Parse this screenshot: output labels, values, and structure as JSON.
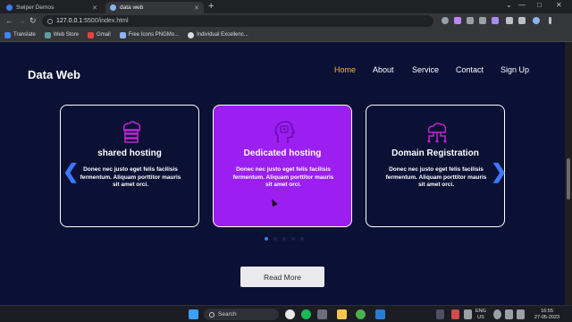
{
  "browser": {
    "tabs": [
      {
        "title": "Swiper Demos",
        "active": false
      },
      {
        "title": "data web",
        "active": true
      }
    ],
    "new_tab_icon": "+",
    "url": {
      "host": "127.0.0.1",
      "path": ":5500/index.html"
    },
    "nav_icons": {
      "back": "←",
      "forward": "→",
      "reload": "↻"
    },
    "window_controls": {
      "minimize": "—",
      "maximize": "□",
      "close": "✕",
      "dropdown": "⌄"
    },
    "bookmarks": [
      {
        "label": "Translate",
        "color": "#4285f4"
      },
      {
        "label": "Web Store",
        "color": "#5f9ea0"
      },
      {
        "label": "Gmail",
        "color": "#ea4335"
      },
      {
        "label": "Free Icons PNGMo...",
        "color": "#8ab4f8"
      },
      {
        "label": "Individual Excellenc...",
        "color": "#dadce0"
      }
    ]
  },
  "site": {
    "logo": "Data Web",
    "nav": [
      {
        "label": "Home",
        "active": true
      },
      {
        "label": "About",
        "active": false
      },
      {
        "label": "Service",
        "active": false
      },
      {
        "label": "Contact",
        "active": false
      },
      {
        "label": "Sign Up",
        "active": false
      }
    ],
    "cards": [
      {
        "title": "shared hosting",
        "text": "Donec nec justo eget felis facilisis fermentum. Aliquam porttitor mauris sit amet orci.",
        "icon": "server-icon",
        "highlighted": false
      },
      {
        "title": "Dedicated hosting",
        "text": "Donec nec justo eget felis facilisis fermentum. Aliquam porttitor mauris sit amet orci.",
        "icon": "brain-head-icon",
        "highlighted": true
      },
      {
        "title": "Domain Registration",
        "text": "Donec nec justo eget felis facilisis fermentum. Aliquam porttitor mauris sit amet orci.",
        "icon": "cloud-network-icon",
        "highlighted": false
      }
    ],
    "prev_arrow": "❮",
    "next_arrow": "❯",
    "pagination": {
      "count": 5,
      "active": 1
    },
    "read_more": "Read More",
    "accent_color": "#f7b733",
    "highlight_color": "#9a1ff0",
    "icon_color": "#c026d3"
  },
  "taskbar": {
    "search_label": "Search",
    "lang": "ENG",
    "region": "US",
    "time": "16:55",
    "date": "27-05-2023"
  }
}
